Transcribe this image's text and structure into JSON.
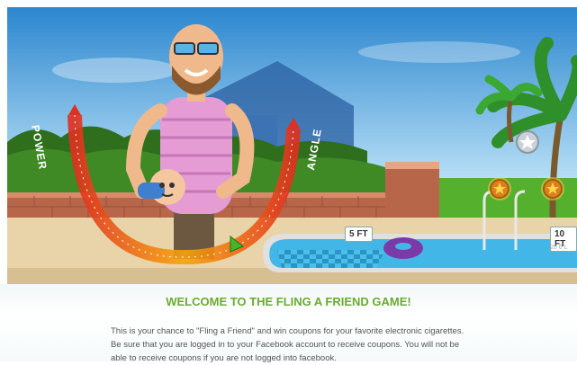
{
  "game": {
    "power_label": "POWER",
    "angle_label": "ANGLE",
    "signs": {
      "five": "5 FT",
      "ten": "10 FT",
      "ten_sub": "20 6 L"
    },
    "icons": [
      "silver-star-coin-icon",
      "gold-star-coin-icon",
      "gold-star-coin-icon"
    ]
  },
  "content": {
    "title": "WELCOME TO THE FLING A FRIEND GAME!",
    "intro": "This is your chance to \"Fling a Friend\" and win coupons for your favorite electronic cigarettes. Be sure that you are logged in to your Facebook account to receive coupons. You will not be able to receive coupons if you are not logged into facebook."
  },
  "colors": {
    "sky": "#2f8fd6",
    "grass": "#4f9a2a",
    "pool": "#43b6e8",
    "accent": "#6aab2e"
  }
}
